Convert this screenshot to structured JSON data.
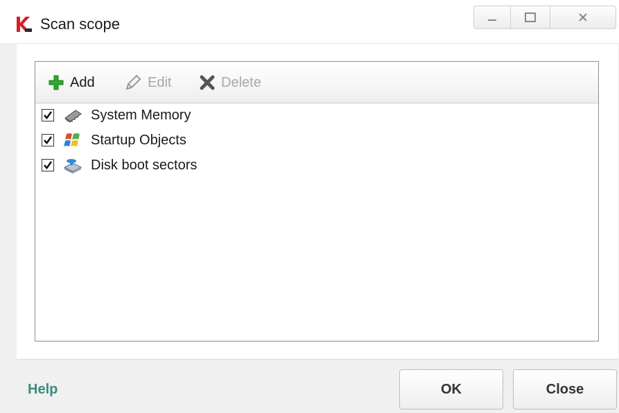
{
  "window": {
    "title": "Scan scope",
    "controls": [
      "minimize",
      "maximize",
      "close"
    ]
  },
  "toolbar": {
    "add_label": "Add",
    "edit_label": "Edit",
    "delete_label": "Delete"
  },
  "scope_items": [
    {
      "label": "System Memory",
      "checked": true,
      "icon": "memory-chip-icon"
    },
    {
      "label": "Startup Objects",
      "checked": true,
      "icon": "windows-flag-icon"
    },
    {
      "label": "Disk boot sectors",
      "checked": true,
      "icon": "disk-drive-icon"
    }
  ],
  "footer": {
    "help_label": "Help",
    "ok_label": "OK",
    "close_label": "Close"
  },
  "colors": {
    "help_link": "#3a8a7f",
    "add_icon": "#2fa82f",
    "disabled_text": "#a8a8a8",
    "brand": "#d4202a"
  }
}
